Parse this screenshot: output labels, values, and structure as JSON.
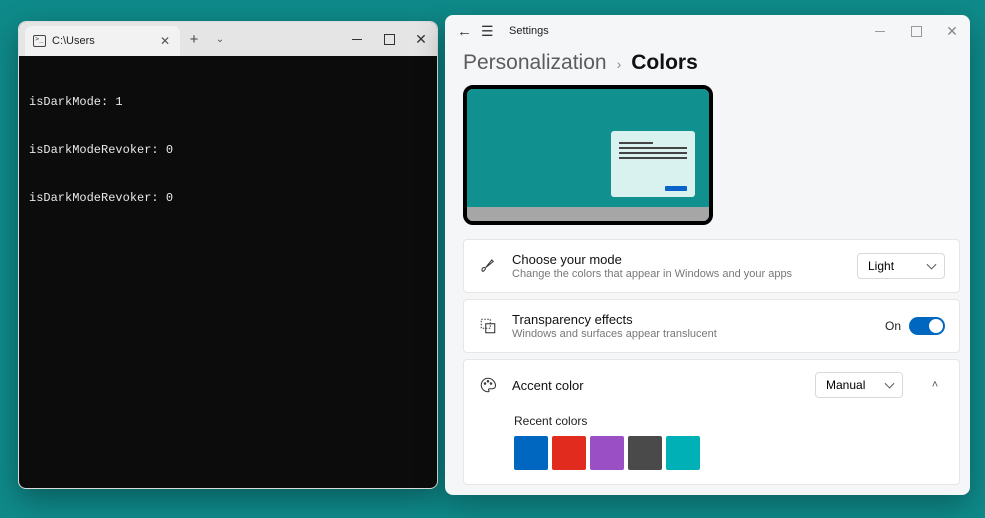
{
  "terminal": {
    "tab_title": "C:\\Users",
    "lines": [
      "isDarkMode: 1",
      "isDarkModeRevoker: 0",
      "isDarkModeRevoker: 0"
    ]
  },
  "settings": {
    "app_title": "Settings",
    "breadcrumb": {
      "parent": "Personalization",
      "current": "Colors"
    },
    "mode": {
      "title": "Choose your mode",
      "subtitle": "Change the colors that appear in Windows and your apps",
      "value": "Light"
    },
    "transparency": {
      "title": "Transparency effects",
      "subtitle": "Windows and surfaces appear translucent",
      "state_label": "On",
      "on": true
    },
    "accent": {
      "title": "Accent color",
      "value": "Manual"
    },
    "recent": {
      "title": "Recent colors",
      "colors": [
        "#0067c0",
        "#e12b1f",
        "#9b4fc5",
        "#4a4a4a",
        "#00b0b7"
      ]
    }
  }
}
